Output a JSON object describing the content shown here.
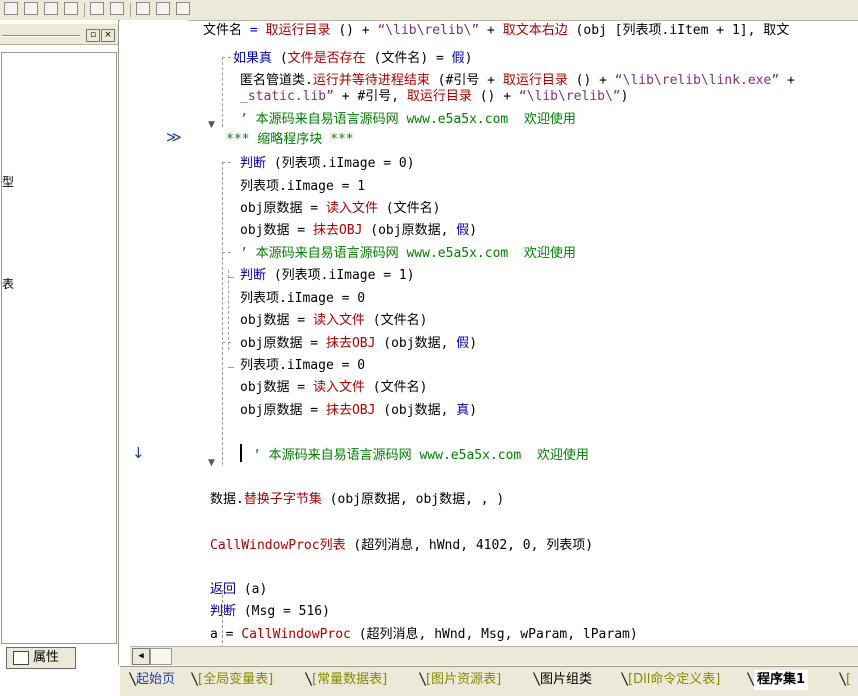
{
  "left_panel": {
    "items": [
      "型",
      "表"
    ],
    "tab_label": "属性"
  },
  "code_lines": [
    [
      {
        "t": "文件名 ",
        "c": "def"
      },
      {
        "t": "= ",
        "c": "kw"
      },
      {
        "t": "取运行目录",
        "c": "fn"
      },
      {
        "t": " () + ",
        "c": "def"
      },
      {
        "t": "“\\lib\\relib\\”",
        "c": "str"
      },
      {
        "t": " + ",
        "c": "def"
      },
      {
        "t": "取文本右边",
        "c": "fn"
      },
      {
        "t": " (obj [列表项.iItem + 1], 取文",
        "c": "def"
      }
    ],
    [
      {
        "t": "如果真",
        "c": "kw"
      },
      {
        "t": " (",
        "c": "def"
      },
      {
        "t": "文件是否存在",
        "c": "fn"
      },
      {
        "t": " (文件名) = ",
        "c": "def"
      },
      {
        "t": "假",
        "c": "kw"
      },
      {
        "t": ")",
        "c": "def"
      }
    ],
    [
      {
        "t": "匿名管道类.",
        "c": "def"
      },
      {
        "t": "运行并等待进程结束",
        "c": "fn"
      },
      {
        "t": " (#引号 + ",
        "c": "def"
      },
      {
        "t": "取运行目录",
        "c": "fn"
      },
      {
        "t": " () + ",
        "c": "def"
      },
      {
        "t": "“\\lib\\relib\\link.exe”",
        "c": "str"
      },
      {
        "t": " +",
        "c": "def"
      }
    ],
    [
      {
        "t": "_static.lib”",
        "c": "str"
      },
      {
        "t": " + #引号, ",
        "c": "def"
      },
      {
        "t": "取运行目录",
        "c": "fn"
      },
      {
        "t": " () + ",
        "c": "def"
      },
      {
        "t": "“\\lib\\relib\\”",
        "c": "str"
      },
      {
        "t": ")",
        "c": "def"
      }
    ],
    [
      {
        "t": "’ 本源码来自易语言源码网 www.e5a5x.com  欢迎使用",
        "c": "cm"
      }
    ],
    [
      {
        "t": "*** 缩略程序块 ***",
        "c": "cm"
      }
    ],
    [
      {
        "t": "判断",
        "c": "kw"
      },
      {
        "t": " (列表项.iImage = 0)",
        "c": "def"
      }
    ],
    [
      {
        "t": "列表项.iImage = 1",
        "c": "def"
      }
    ],
    [
      {
        "t": "obj原数据 = ",
        "c": "def"
      },
      {
        "t": "读入文件",
        "c": "fn"
      },
      {
        "t": " (文件名)",
        "c": "def"
      }
    ],
    [
      {
        "t": "obj数据 = ",
        "c": "def"
      },
      {
        "t": "抹去OBJ",
        "c": "fn"
      },
      {
        "t": " (obj原数据, ",
        "c": "def"
      },
      {
        "t": "假",
        "c": "kw"
      },
      {
        "t": ")",
        "c": "def"
      }
    ],
    [
      {
        "t": "’ 本源码来自易语言源码网 www.e5a5x.com  欢迎使用",
        "c": "cm"
      }
    ],
    [
      {
        "t": "判断",
        "c": "kw"
      },
      {
        "t": " (列表项.iImage = 1)",
        "c": "def"
      }
    ],
    [
      {
        "t": "列表项.iImage = 0",
        "c": "def"
      }
    ],
    [
      {
        "t": "obj数据 = ",
        "c": "def"
      },
      {
        "t": "读入文件",
        "c": "fn"
      },
      {
        "t": " (文件名)",
        "c": "def"
      }
    ],
    [
      {
        "t": "obj原数据 = ",
        "c": "def"
      },
      {
        "t": "抹去OBJ",
        "c": "fn"
      },
      {
        "t": " (obj数据, ",
        "c": "def"
      },
      {
        "t": "假",
        "c": "kw"
      },
      {
        "t": ")",
        "c": "def"
      }
    ],
    [
      {
        "t": "列表项.iImage = 0",
        "c": "def"
      }
    ],
    [
      {
        "t": "obj数据 = ",
        "c": "def"
      },
      {
        "t": "读入文件",
        "c": "fn"
      },
      {
        "t": " (文件名)",
        "c": "def"
      }
    ],
    [
      {
        "t": "obj原数据 = ",
        "c": "def"
      },
      {
        "t": "抹去OBJ",
        "c": "fn"
      },
      {
        "t": " (obj数据, ",
        "c": "def"
      },
      {
        "t": "真",
        "c": "kw"
      },
      {
        "t": ")",
        "c": "def"
      }
    ],
    [
      {
        "t": "’ 本源码来自易语言源码网 www.e5a5x.com  欢迎使用",
        "c": "cm"
      }
    ],
    [
      {
        "t": "数据.",
        "c": "def"
      },
      {
        "t": "替换子字节集",
        "c": "fn"
      },
      {
        "t": " (obj原数据, obj数据, , )",
        "c": "def"
      }
    ],
    [
      {
        "t": "CallWindowProc列表",
        "c": "fn"
      },
      {
        "t": " (超列消息, hWnd, 4102, 0, 列表项)",
        "c": "def"
      }
    ],
    [
      {
        "t": "返回",
        "c": "kw"
      },
      {
        "t": " (a)",
        "c": "def"
      }
    ],
    [
      {
        "t": "判断",
        "c": "kw"
      },
      {
        "t": " (Msg = 516)",
        "c": "def"
      }
    ],
    [
      {
        "t": "a = ",
        "c": "def"
      },
      {
        "t": "CallWindowProc",
        "c": "fn"
      },
      {
        "t": " (超列消息, hWnd, Msg, wParam, lParam)",
        "c": "def"
      }
    ]
  ],
  "tabs": [
    {
      "label": "起始页",
      "color": "#1f3fa7",
      "active": false
    },
    {
      "label": "[全局变量表]",
      "color": "#8a8a00",
      "active": false
    },
    {
      "label": "[常量数据表]",
      "color": "#8a8a00",
      "active": false
    },
    {
      "label": "[图片资源表]",
      "color": "#8a8a00",
      "active": false
    },
    {
      "label": "图片组类",
      "color": "#000000",
      "active": false
    },
    {
      "label": "[Dll命令定义表]",
      "color": "#8a8a00",
      "active": false
    },
    {
      "label": "程序集1",
      "color": "#000000",
      "active": true
    },
    {
      "label": "[",
      "color": "#8a8a00",
      "active": false
    }
  ]
}
